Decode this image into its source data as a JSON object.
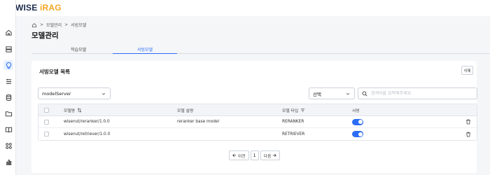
{
  "app": {
    "logo_main": "WISE ",
    "logo_accent": "iRAG"
  },
  "sidebar": {
    "items": [
      {
        "icon": "home-icon"
      },
      {
        "icon": "server-icon"
      },
      {
        "icon": "lightbulb-icon",
        "active": true
      },
      {
        "icon": "sliders-icon"
      },
      {
        "icon": "database-icon"
      },
      {
        "icon": "folder-icon"
      },
      {
        "icon": "book-icon"
      },
      {
        "icon": "grid-icon"
      },
      {
        "icon": "chart-icon"
      }
    ]
  },
  "breadcrumb": {
    "level1": "모델관리",
    "level2": "서빙모델"
  },
  "page": {
    "title": "모델관리"
  },
  "tabs": [
    {
      "label": "학습모델"
    },
    {
      "label": "서빙모델",
      "active": true
    }
  ],
  "card": {
    "title": "서빙모델 목록",
    "delete_label": "삭제",
    "model_select_value": "modelServer",
    "choice_select_value": "선택",
    "search_placeholder": "검색어를 입력해주세요."
  },
  "table": {
    "headers": {
      "name": "모델명",
      "desc": "모델 설명",
      "type": "모델 타입",
      "serving": "서빙"
    },
    "rows": [
      {
        "name": "wisenut/reranker/1.0.0",
        "desc": "reranker base model",
        "type": "RERANKER",
        "serving": true
      },
      {
        "name": "wisenut/retriever/1.0.0",
        "desc": "",
        "type": "RETRIEVER",
        "serving": true
      }
    ]
  },
  "pagination": {
    "prev_label": "이전",
    "current_page": "1",
    "next_label": "다음"
  },
  "colors": {
    "accent": "#2c6cf6",
    "logo_accent": "#f5a623"
  }
}
